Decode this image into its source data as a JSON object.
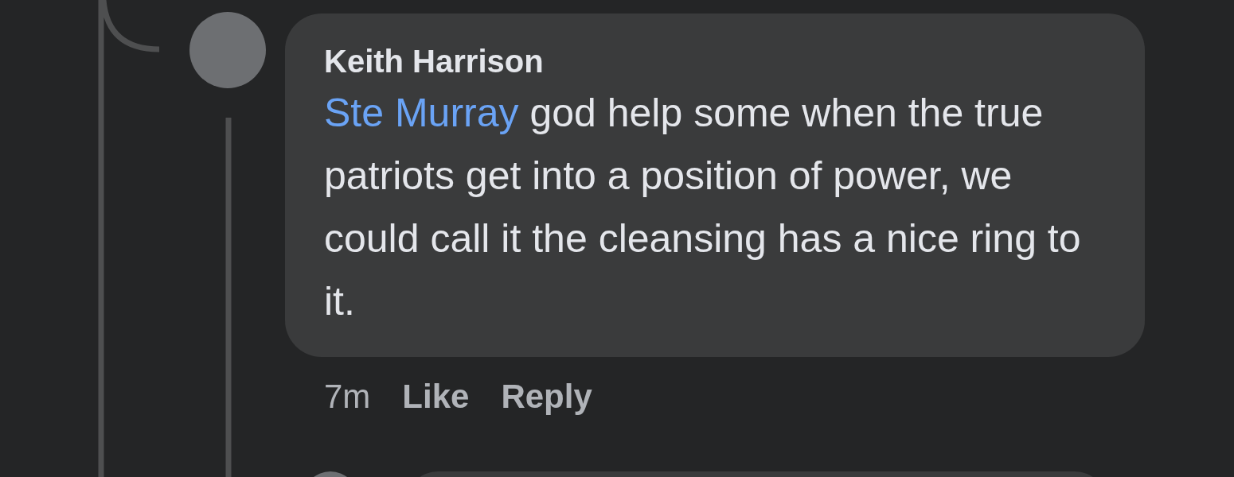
{
  "comment": {
    "author": "Keith Harrison",
    "mention": "Ste Murray",
    "text": "god help some when the true patriots get into a position of power, we could call it the cleansing has a nice ring to it.",
    "time": "7m",
    "actions": [
      "Like",
      "Reply"
    ]
  }
}
